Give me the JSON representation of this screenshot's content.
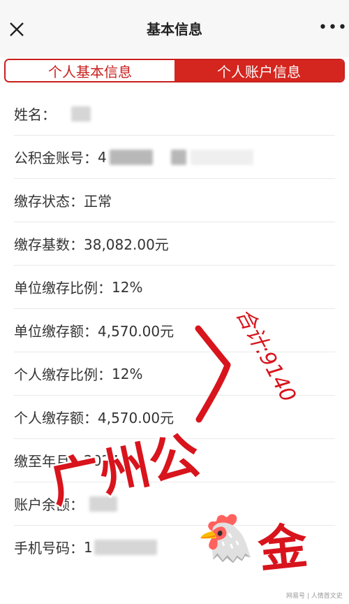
{
  "header": {
    "title": "基本信息",
    "close_icon": "close-icon",
    "more_icon": "more-icon"
  },
  "tabs": [
    {
      "label": "个人基本信息",
      "active": false
    },
    {
      "label": "个人账户信息",
      "active": true
    }
  ],
  "rows": [
    {
      "label": "姓名：",
      "value": ""
    },
    {
      "label": "公积金账号：",
      "value": "4"
    },
    {
      "label": "缴存状态：",
      "value": "正常"
    },
    {
      "label": "缴存基数：",
      "value": "38,082.00元"
    },
    {
      "label": "单位缴存比例：",
      "value": "12%"
    },
    {
      "label": "单位缴存额：",
      "value": "4,570.00元"
    },
    {
      "label": "个人缴存比例：",
      "value": "12%"
    },
    {
      "label": "个人缴存额：",
      "value": "4,570.00元"
    },
    {
      "label": "缴至年月：",
      "value": "2024-04"
    },
    {
      "label": "账户余额：",
      "value": ""
    },
    {
      "label": "手机号码：",
      "value": "1"
    }
  ],
  "annotations": {
    "handwritten_total": "合计:9140",
    "overlay_text_left": "广州公",
    "overlay_text_right": "金",
    "emoji": "🐔"
  },
  "watermark": "网易号 | 人情首文史",
  "colors": {
    "brand_red": "#d4261f",
    "annotation_red": "#d8141c"
  }
}
